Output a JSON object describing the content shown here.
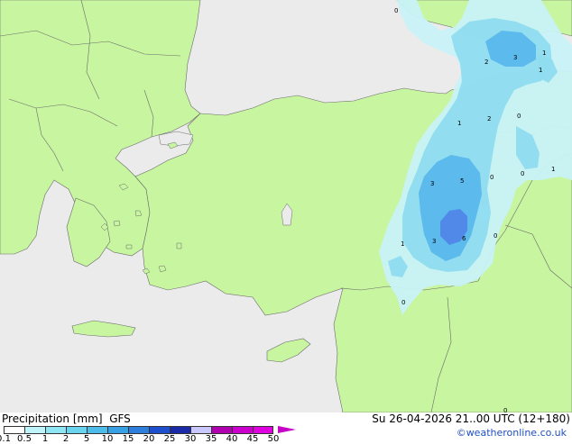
{
  "footer": {
    "title": "Precipitation [mm]  GFS",
    "time": "Su 26-04-2026 21..00 UTC (12+180)",
    "credit": "©weatheronline.co.uk"
  },
  "legend": {
    "values": [
      "0.1",
      "0.5",
      "1",
      "2",
      "5",
      "10",
      "15",
      "20",
      "25",
      "30",
      "35",
      "40",
      "45",
      "50"
    ],
    "colors": [
      "#ffffff",
      "#bff4fa",
      "#8ee6f4",
      "#6ad4ef",
      "#4cbcea",
      "#38a0e4",
      "#2e7ede",
      "#1e4fcf",
      "#1a2aa8",
      "#c8c8ff",
      "#b000b0",
      "#cc00cc",
      "#e000e0",
      "#ee30ee"
    ]
  },
  "colors": {
    "land": "#c8f5a0",
    "sea": "#ebebeb",
    "border": "#6a6a6a",
    "precip_light": "#c9f2f7",
    "precip_mid": "#8fdcef",
    "precip_heavy": "#5ab7ec",
    "precip_peak": "#4f86e8"
  },
  "map_labels": {
    "l1": "3",
    "l2": "1",
    "l3": "2",
    "l4": "1",
    "l5": "1",
    "l6": "2",
    "l7": "0",
    "l8": "0",
    "l9": "1",
    "l10": "3",
    "l11": "5",
    "l12": "0",
    "l13": "1",
    "l14": "3",
    "l15": "6",
    "l16": "0",
    "l17": "0",
    "l18": "0",
    "l19": "0"
  }
}
